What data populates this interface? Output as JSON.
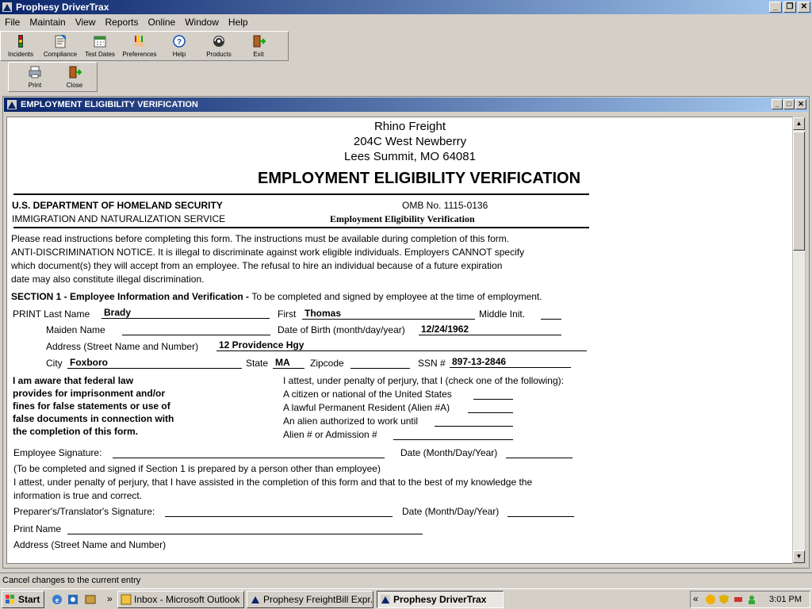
{
  "app": {
    "title": "Prophesy DriverTrax"
  },
  "menu": [
    "File",
    "Maintain",
    "View",
    "Reports",
    "Online",
    "Window",
    "Help"
  ],
  "toolbar": {
    "main": [
      "Incidents",
      "Compliance",
      "Test Dates",
      "Preferences",
      "Help",
      "Products",
      "Exit"
    ],
    "secondary": [
      "Print",
      "Close"
    ]
  },
  "child_window": {
    "title": "EMPLOYMENT ELIGIBILITY VERIFICATION"
  },
  "doc": {
    "company": "Rhino Freight",
    "address1": "204C West Newberry",
    "address2": "Lees Summit, MO 64081",
    "form_title": "EMPLOYMENT ELIGIBILITY VERIFICATION",
    "dept": "U.S. DEPARTMENT OF HOMELAND SECURITY",
    "service": "IMMIGRATION AND NATURALIZATION SERVICE",
    "omb": "OMB No. 1115-0136",
    "subtitle": "Employment Eligibility Verification",
    "instructions": [
      "Please read instructions before completing this form.  The instructions must be available during completion of this form.",
      "ANTI-DISCRIMINATION NOTICE. It is illegal to discriminate against work eligible individuals.  Employers CANNOT specify",
      "which document(s) they will accept from an employee.  The refusal to hire an individual because of a future expiration",
      "date may also constitute illegal discrimination."
    ],
    "section1_title": "SECTION 1 - Employee Information and Verification - ",
    "section1_desc": "To be completed and signed by employee at the time of employment.",
    "labels": {
      "last_name": "PRINT Last Name",
      "first": "First",
      "middle": "Middle Init.",
      "maiden": "Maiden Name",
      "dob": "Date of Birth (month/day/year)",
      "address": "Address (Street Name and Number)",
      "city": "City",
      "state": "State",
      "zip": "Zipcode",
      "ssn": "SSN #"
    },
    "values": {
      "last_name": "Brady",
      "first": "Thomas",
      "middle": "",
      "maiden": "",
      "dob": "12/24/1962",
      "address": "12 Providence Hgy",
      "city": "Foxboro",
      "state": "MA",
      "zip": "",
      "ssn": "897-13-2846"
    },
    "warning": [
      "I am aware that federal law",
      "provides for imprisonment and/or",
      "fines for false statements or use of",
      "false documents in connection with",
      "the completion of this form."
    ],
    "attest": [
      "I attest, under penalty of perjury, that I (check one of the following):",
      "A citizen or national of the United States",
      "A lawful Permanent Resident (Alien #A)",
      "An alien authorized to work until",
      "Alien # or Admission #"
    ],
    "emp_sig": "Employee Signature:",
    "date_label": "Date (Month/Day/Year)",
    "preparer_note": "(To be completed and signed if Section 1 is prepared by a person other than employee)",
    "preparer_attest": [
      "I attest, under penalty of perjury, that I have assisted in the completion of this form and that to the best of my knowledge the",
      "information is true and correct."
    ],
    "prep_sig": "Preparer's/Translator's Signature:",
    "print_name": "Print Name",
    "prep_address": "Address (Street Name and Number)"
  },
  "statusbar": "Cancel changes to the current entry",
  "taskbar": {
    "start": "Start",
    "tasks": [
      "Inbox - Microsoft Outlook",
      "Prophesy FreightBill Expr...",
      "Prophesy DriverTrax"
    ],
    "clock": "3:01 PM"
  }
}
